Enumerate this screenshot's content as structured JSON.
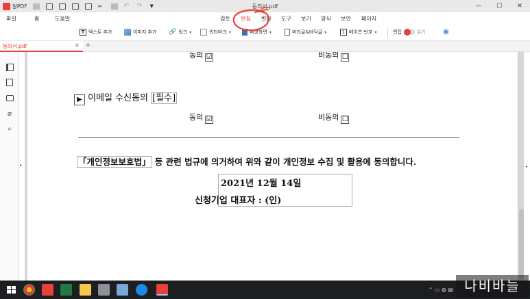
{
  "window": {
    "app_name": "알PDF",
    "title": "동의서.pdf",
    "controls": {
      "minimize": "—",
      "maximize": "☐",
      "close": "✕"
    }
  },
  "menu": {
    "items": [
      "파일",
      "홈",
      "도움말",
      "검토",
      "편집",
      "변환",
      "도구",
      "보기",
      "양식",
      "보안",
      "페이지"
    ],
    "active": "편집"
  },
  "ribbon": {
    "add_text": "텍스트 추가",
    "add_image": "이미지 추가",
    "link": "링크",
    "watermark": "워터마크",
    "background": "배경화면",
    "header_footer": "머리글&바닥글",
    "bates": "베이츠 번호",
    "edit": "편집",
    "read": "읽기"
  },
  "tabs": {
    "document": "동의서.pdf",
    "add": "+"
  },
  "document": {
    "top_agree": "동의",
    "top_disagree": "비동의",
    "email_section": "이메일 수신동의",
    "required": "[필수]",
    "agree": "동의",
    "disagree": "비동의",
    "checked": "☑",
    "unchecked": "☐",
    "law_name": "「개인정보보호법」",
    "statement": "등 관련 법규에 의거하여 위와 같이 개인정보 수집 및 활용에 동의합니다.",
    "date": "2021년  12월  14일",
    "applicant": "신청기업 대표자 :           (인)"
  },
  "watermark_text": "나비바늘",
  "colors": {
    "accent": "#e8413a",
    "titlebar": "#e9e9ea",
    "doc_bg": "#d6d6d6",
    "taskbar": "#1d1e22"
  }
}
